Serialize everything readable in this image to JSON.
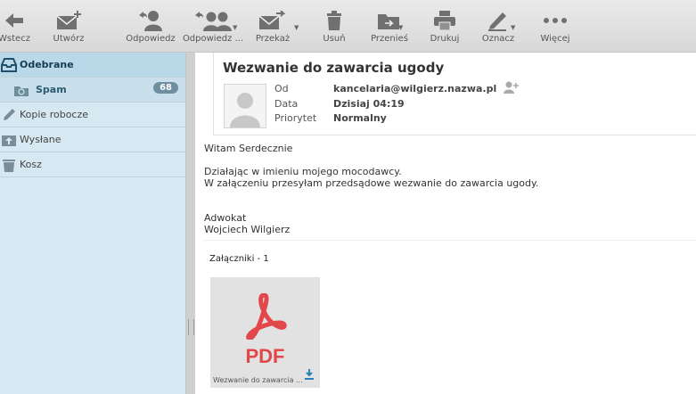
{
  "toolbar": {
    "back": "Wstecz",
    "compose": "Utwórz",
    "reply": "Odpowiedz",
    "reply_all": "Odpowiedz ...",
    "forward": "Przekaż",
    "delete": "Usuń",
    "move": "Przenieś",
    "print": "Drukuj",
    "mark": "Oznacz",
    "more": "Więcej"
  },
  "folders": [
    {
      "label": "Odebrane",
      "icon": "inbox-icon"
    },
    {
      "label": "Spam",
      "icon": "spam-icon",
      "count": "68"
    },
    {
      "label": "Kopie robocze",
      "icon": "pencil-icon"
    },
    {
      "label": "Wysłane",
      "icon": "sent-icon"
    },
    {
      "label": "Kosz",
      "icon": "trash-icon"
    }
  ],
  "message": {
    "subject": "Wezwanie do zawarcia ugody",
    "from_label": "Od",
    "from": "kancelaria@wilgierz.nazwa.pl",
    "date_label": "Data",
    "date": "Dzisiaj 04:19",
    "priority_label": "Priorytet",
    "priority": "Normalny",
    "body": {
      "greeting": "Witam Serdecznie",
      "line1": "Działając w imieniu mojego mocodawcy.",
      "line2": "W załączeniu przesyłam przedsądowe wezwanie do zawarcia ugody.",
      "sig1": "Adwokat",
      "sig2": "Wojciech Wilgierz"
    },
    "attachments_title": "Załączniki - 1",
    "attachment": {
      "type": "PDF",
      "name": "Wezwanie do zawarcia ..."
    }
  },
  "colors": {
    "pdf_red": "#e2474a",
    "sidebar": "#d6e8f1",
    "accent": "#2b7fb8"
  }
}
